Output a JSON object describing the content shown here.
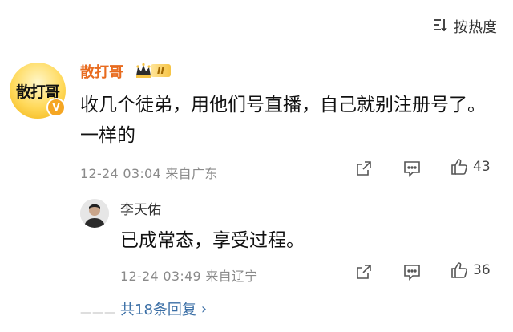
{
  "sort": {
    "label": "按热度",
    "icon": "sort-lines-icon"
  },
  "comment": {
    "avatar_text": "散打哥",
    "avatar_badge": "V",
    "username": "散打哥",
    "level_badge": "II",
    "content": "收几个徒弟，用他们号直播，自己就别注册号了。一样的",
    "meta": "12-24 03:04  来自广东",
    "likes": "43"
  },
  "reply": {
    "username": "李天佑",
    "content": "已成常态，享受过程。",
    "meta": "12-24 03:49  来自辽宁",
    "likes": "36"
  },
  "more_replies": {
    "dots": "———",
    "label": "共18条回复",
    "chevron": "›"
  },
  "colors": {
    "username_main": "#e86b1f",
    "link_blue": "#3a6ea5",
    "meta_gray": "#8a8a8a",
    "badge_gold": "#f6c445"
  }
}
